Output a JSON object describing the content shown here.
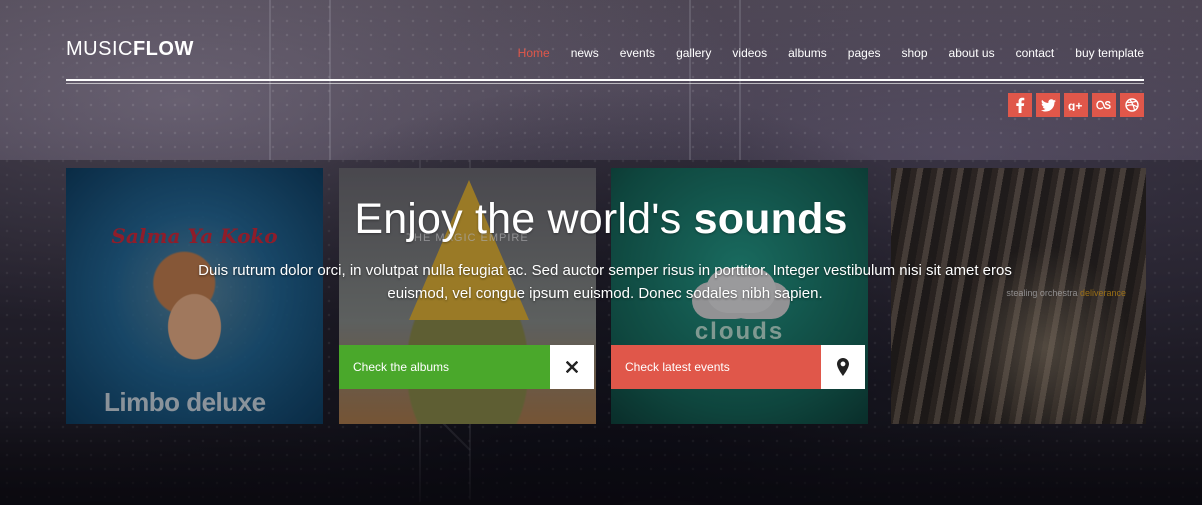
{
  "brand": {
    "light": "MUSIC",
    "bold": "FLOW"
  },
  "nav": {
    "items": [
      {
        "label": "Home",
        "active": true
      },
      {
        "label": "news"
      },
      {
        "label": "events"
      },
      {
        "label": "gallery"
      },
      {
        "label": "videos"
      },
      {
        "label": "albums"
      },
      {
        "label": "pages"
      },
      {
        "label": "shop"
      },
      {
        "label": "about us"
      },
      {
        "label": "contact"
      },
      {
        "label": "buy template"
      }
    ]
  },
  "social": {
    "icons": [
      "facebook-icon",
      "twitter-icon",
      "google-plus-icon",
      "lastfm-icon",
      "dribbble-icon"
    ],
    "color": "#e0574a"
  },
  "albums": [
    {
      "title": "Salma Ya Koko",
      "footer": "Limbo deluxe"
    },
    {
      "title": "THE MAGIC EMPIRE"
    },
    {
      "title": "clouds"
    },
    {
      "title_prefix": "stealing orchestra",
      "title_accent": "deliverance"
    }
  ],
  "hero": {
    "title_light": "Enjoy the world's",
    "title_bold": "sounds",
    "description": "Duis rutrum dolor orci, in volutpat nulla feugiat ac. Sed auctor semper risus in porttitor. Integer vestibulum nisi sit amet eros euismod, vel congue ipsum euismod. Donec sodales nibh sapien."
  },
  "cta": {
    "albums": {
      "label": "Check the albums",
      "icon": "close-icon",
      "color": "#4aa82b"
    },
    "events": {
      "label": "Check latest events",
      "icon": "map-pin-icon",
      "color": "#e0574a"
    }
  },
  "colors": {
    "accent": "#e0574a",
    "green": "#4aa82b"
  }
}
